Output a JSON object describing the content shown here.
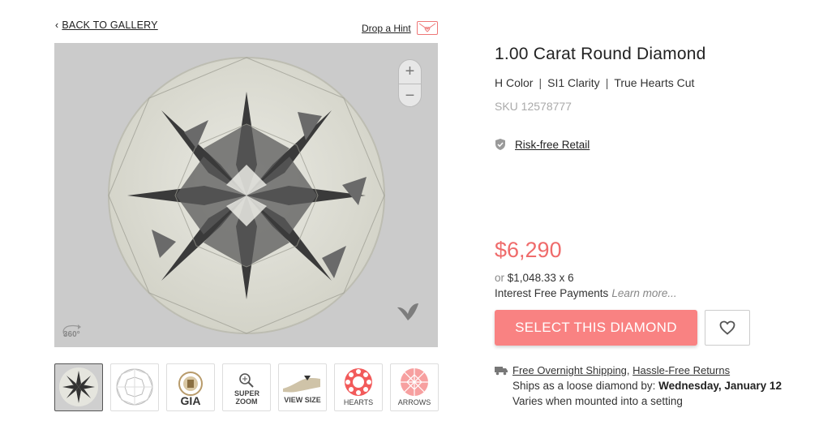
{
  "nav": {
    "back_label": "BACK TO GALLERY",
    "hint_label": "Drop a Hint"
  },
  "viewer": {
    "zoom_in": "+",
    "zoom_out": "−",
    "rotate_label": "360°"
  },
  "thumbnails": [
    {
      "name": "thumb-diamond-photo",
      "caption": ""
    },
    {
      "name": "thumb-diagram",
      "caption": ""
    },
    {
      "name": "thumb-gia",
      "caption": "GIA"
    },
    {
      "name": "thumb-super-zoom",
      "caption": "SUPER ZOOM"
    },
    {
      "name": "thumb-view-size",
      "caption": "VIEW SIZE"
    },
    {
      "name": "thumb-hearts",
      "caption": "HEARTS"
    },
    {
      "name": "thumb-arrows",
      "caption": "ARROWS"
    }
  ],
  "product": {
    "title": "1.00 Carat Round Diamond",
    "color": "H Color",
    "clarity": "SI1 Clarity",
    "cut": "True Hearts Cut",
    "sku": "SKU 12578777",
    "risk_free": "Risk-free Retail",
    "price": "$6,290",
    "monthly_prefix": "or",
    "monthly": "$1,048.33 x 6",
    "interest_free": "Interest Free Payments",
    "learn_more": "Learn more..."
  },
  "actions": {
    "select_label": "SELECT THIS DIAMOND"
  },
  "shipping": {
    "free_shipping": "Free Overnight Shipping",
    "separator": ",",
    "returns": "Hassle-Free Returns",
    "ships_prefix": "Ships as a loose diamond by:",
    "ships_date": "Wednesday, January 12",
    "varies": "Varies when mounted into a setting"
  },
  "colors": {
    "accent": "#f98282",
    "price": "#ef6b6b"
  }
}
